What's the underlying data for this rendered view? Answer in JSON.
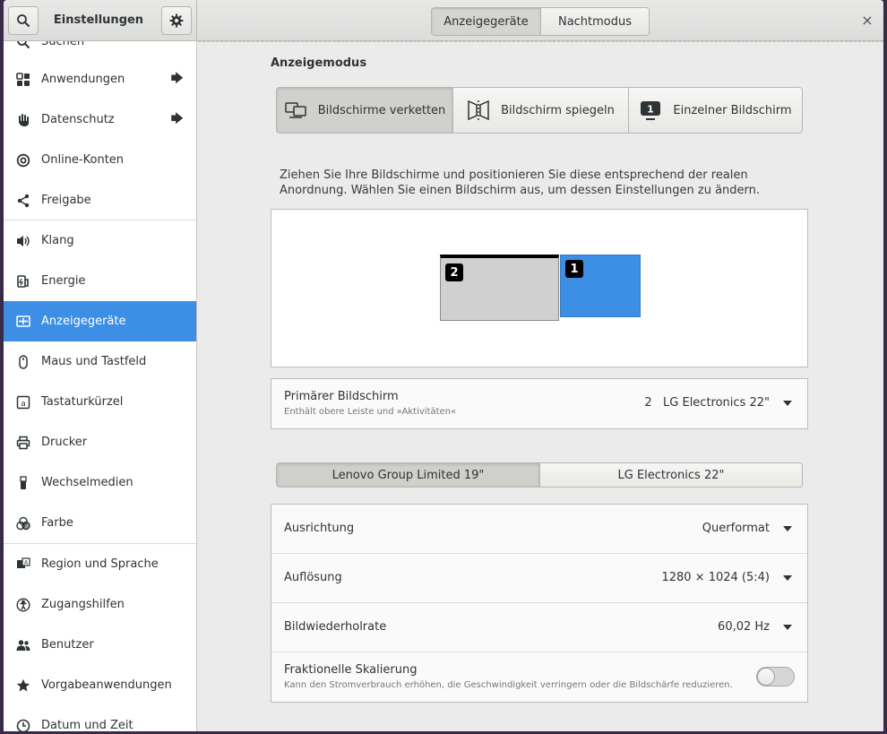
{
  "header": {
    "title": "Einstellungen",
    "view_tabs": [
      "Anzeigegeräte",
      "Nachtmodus"
    ],
    "active_view": 0,
    "close_label": "×"
  },
  "sidebar": {
    "items": [
      {
        "label": "Suchen",
        "icon": "search-icon"
      },
      {
        "label": "Anwendungen",
        "icon": "apps-icon",
        "arrow": "🡆"
      },
      {
        "label": "Datenschutz",
        "icon": "hand-icon",
        "arrow": "🡆"
      },
      {
        "label": "Online-Konten",
        "icon": "at-icon"
      },
      {
        "label": "Freigabe",
        "icon": "share-icon"
      },
      {
        "label": "Klang",
        "icon": "speaker-icon"
      },
      {
        "label": "Energie",
        "icon": "power-plug-icon"
      },
      {
        "label": "Anzeigegeräte",
        "icon": "display-icon"
      },
      {
        "label": "Maus und Tastfeld",
        "icon": "mouse-icon"
      },
      {
        "label": "Tastaturkürzel",
        "icon": "keyboard-key-icon"
      },
      {
        "label": "Drucker",
        "icon": "printer-icon"
      },
      {
        "label": "Wechselmedien",
        "icon": "usb-stick-icon"
      },
      {
        "label": "Farbe",
        "icon": "color-icon"
      },
      {
        "label": "Region und Sprache",
        "icon": "language-icon"
      },
      {
        "label": "Zugangshilfen",
        "icon": "accessibility-icon"
      },
      {
        "label": "Benutzer",
        "icon": "users-icon"
      },
      {
        "label": "Vorgabeanwendungen",
        "icon": "star-icon"
      },
      {
        "label": "Datum und Zeit",
        "icon": "clock-icon"
      }
    ],
    "active_index": 7
  },
  "display": {
    "mode_title": "Anzeigemodus",
    "modes": [
      "Bildschirme verketten",
      "Bildschirm spiegeln",
      "Einzelner Bildschirm"
    ],
    "single_mode_badge": "1",
    "active_mode": 0,
    "instruction": "Ziehen Sie Ihre Bildschirme und positionieren Sie diese entsprechend der realen Anordnung. Wählen Sie einen Bildschirm aus, um dessen Einstellungen zu ändern.",
    "monitor_badges": [
      "2",
      "1"
    ],
    "primary": {
      "label": "Primärer Bildschirm",
      "sublabel": "Enthält obere Leiste und »Aktivitäten«",
      "value_number": "2",
      "value_name": "LG Electronics 22\""
    },
    "monitor_tabs": [
      "Lenovo Group Limited 19\"",
      "LG Electronics 22\""
    ],
    "active_monitor_tab": 0,
    "settings": {
      "orientation_label": "Ausrichtung",
      "orientation_value": "Querformat",
      "resolution_label": "Auflösung",
      "resolution_value": "1280 × 1024 (5:4)",
      "refresh_label": "Bildwiederholrate",
      "refresh_value": "60,02 Hz",
      "scaling_label": "Fraktionelle Skalierung",
      "scaling_sublabel": "Kann den Stromverbrauch erhöhen, die Geschwindigkeit verringern oder die Bildschärfe reduzieren.",
      "scaling_enabled": false
    }
  },
  "colors": {
    "accent": "#3d8fe5"
  }
}
